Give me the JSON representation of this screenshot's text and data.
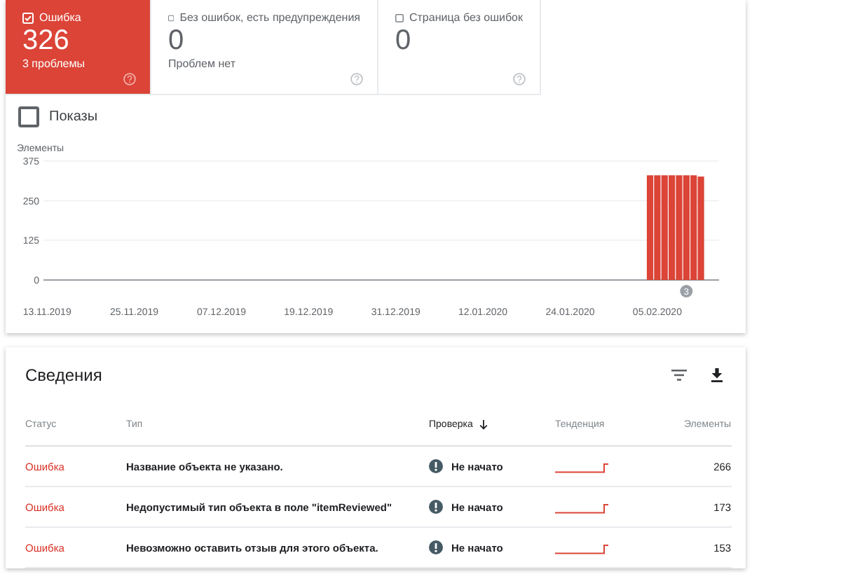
{
  "status_tiles": [
    {
      "label": "Ошибка",
      "count": "326",
      "subtitle": "3 проблемы",
      "selected": true,
      "checked": true
    },
    {
      "label": "Без ошибок, есть предупреждения",
      "count": "0",
      "subtitle": "Проблем нет",
      "selected": false,
      "checked": false
    },
    {
      "label": "Страница без ошибок",
      "count": "0",
      "selected": false,
      "checked": false
    }
  ],
  "impressions": {
    "label": "Показы",
    "checked": false
  },
  "chart": {
    "chart_data": {
      "type": "bar",
      "ylabel": "Элементы",
      "categories": [
        "13.11.2019",
        null,
        null,
        null,
        null,
        null,
        null,
        null,
        null,
        null,
        null,
        null,
        "25.11.2019",
        null,
        null,
        null,
        null,
        null,
        null,
        null,
        null,
        null,
        null,
        null,
        "07.12.2019",
        null,
        null,
        null,
        null,
        null,
        null,
        null,
        null,
        null,
        null,
        null,
        "19.12.2019",
        null,
        null,
        null,
        null,
        null,
        null,
        null,
        null,
        null,
        null,
        null,
        "31.12.2019",
        null,
        null,
        null,
        null,
        null,
        null,
        null,
        null,
        null,
        null,
        null,
        "12.01.2020",
        null,
        null,
        null,
        null,
        null,
        null,
        null,
        null,
        null,
        null,
        null,
        "24.01.2020",
        null,
        null,
        null,
        null,
        null,
        null,
        null,
        null,
        null,
        null,
        null,
        "05.02.2020",
        null,
        null,
        null,
        null,
        null,
        null,
        null,
        null
      ],
      "series": [
        {
          "color": "#db4437",
          "values": [
            null,
            null,
            null,
            null,
            null,
            null,
            null,
            null,
            null,
            null,
            null,
            null,
            null,
            null,
            null,
            null,
            null,
            null,
            null,
            null,
            null,
            null,
            null,
            null,
            null,
            null,
            null,
            null,
            null,
            null,
            null,
            null,
            null,
            null,
            null,
            null,
            null,
            null,
            null,
            null,
            null,
            null,
            null,
            null,
            null,
            null,
            null,
            null,
            null,
            null,
            null,
            null,
            null,
            null,
            null,
            null,
            null,
            null,
            null,
            null,
            null,
            null,
            null,
            null,
            null,
            null,
            null,
            null,
            null,
            null,
            null,
            null,
            null,
            null,
            null,
            null,
            null,
            null,
            null,
            null,
            null,
            null,
            null,
            330,
            330,
            330,
            330,
            330,
            330,
            330,
            326,
            null,
            null
          ]
        }
      ],
      "ylim": [
        0,
        375
      ],
      "yticks": [
        0,
        125,
        250,
        375
      ],
      "annotations": [
        "3"
      ]
    }
  },
  "details": {
    "title": "Сведения",
    "columns": [
      "Статус",
      "Тип",
      "Проверка",
      "Тенденция",
      "Элементы"
    ],
    "rows": [
      {
        "status": "Ошибка",
        "type": "Название объекта не указано.",
        "check": "Не начато",
        "count": "266"
      },
      {
        "status": "Ошибка",
        "type": "Недопустимый тип объекта в поле \"itemReviewed\"",
        "check": "Не начато",
        "count": "173"
      },
      {
        "status": "Ошибка",
        "type": "Невозможно оставить отзыв для этого объекта.",
        "check": "Не начато",
        "count": "153"
      }
    ]
  }
}
